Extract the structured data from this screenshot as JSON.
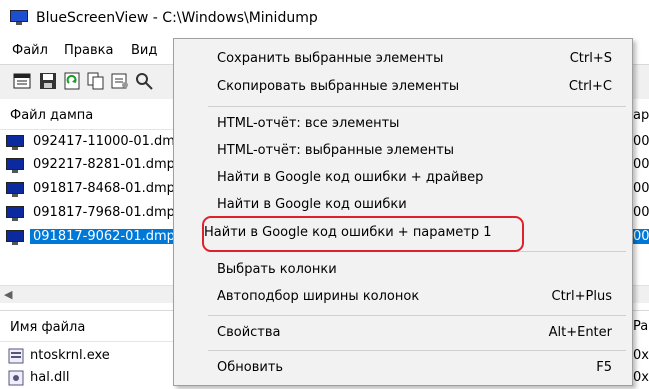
{
  "window": {
    "title": "BlueScreenView  -  C:\\Windows\\Minidump"
  },
  "menubar": {
    "items": [
      "Файл",
      "Правка",
      "Вид"
    ]
  },
  "upper_list": {
    "column_header": "Файл дампа",
    "rows": [
      {
        "label": "092417-11000-01.dmp",
        "selected": false
      },
      {
        "label": "092217-8281-01.dmp",
        "selected": false
      },
      {
        "label": "091817-8468-01.dmp",
        "selected": false
      },
      {
        "label": "091817-7968-01.dmp",
        "selected": false
      },
      {
        "label": "091817-9062-01.dmp",
        "selected": true
      }
    ],
    "right_edge": {
      "header": "ар",
      "rows": [
        "00",
        "00",
        "00",
        "00",
        "00"
      ]
    }
  },
  "lower_list": {
    "column_header": "Имя файла",
    "rows": [
      {
        "label": "ntoskrnl.exe"
      },
      {
        "label": "hal.dll"
      }
    ],
    "right_edge": {
      "header": "Pa",
      "rows": [
        "0x",
        "0x"
      ]
    }
  },
  "context_menu": {
    "items": [
      {
        "label": "Сохранить выбранные элементы",
        "shortcut": "Ctrl+S"
      },
      {
        "label": "Скопировать выбранные элементы",
        "shortcut": "Ctrl+C"
      },
      {
        "label": "HTML-отчёт: все элементы",
        "shortcut": ""
      },
      {
        "label": "HTML-отчёт: выбранные элементы",
        "shortcut": ""
      },
      {
        "label": "Найти в Google код ошибки + драйвер",
        "shortcut": ""
      },
      {
        "label": "Найти в Google код ошибки",
        "shortcut": ""
      },
      {
        "label": "Найти в Google код ошибки + параметр 1",
        "shortcut": ""
      },
      {
        "label": "Выбрать колонки",
        "shortcut": ""
      },
      {
        "label": "Автоподбор ширины колонок",
        "shortcut": "Ctrl+Plus"
      },
      {
        "label": "Свойства",
        "shortcut": "Alt+Enter"
      },
      {
        "label": "Обновить",
        "shortcut": "F5"
      }
    ],
    "highlight_color": "#e0202a"
  },
  "colors": {
    "selection": "#0078d7",
    "dump_icon": "#0a2a9e"
  }
}
